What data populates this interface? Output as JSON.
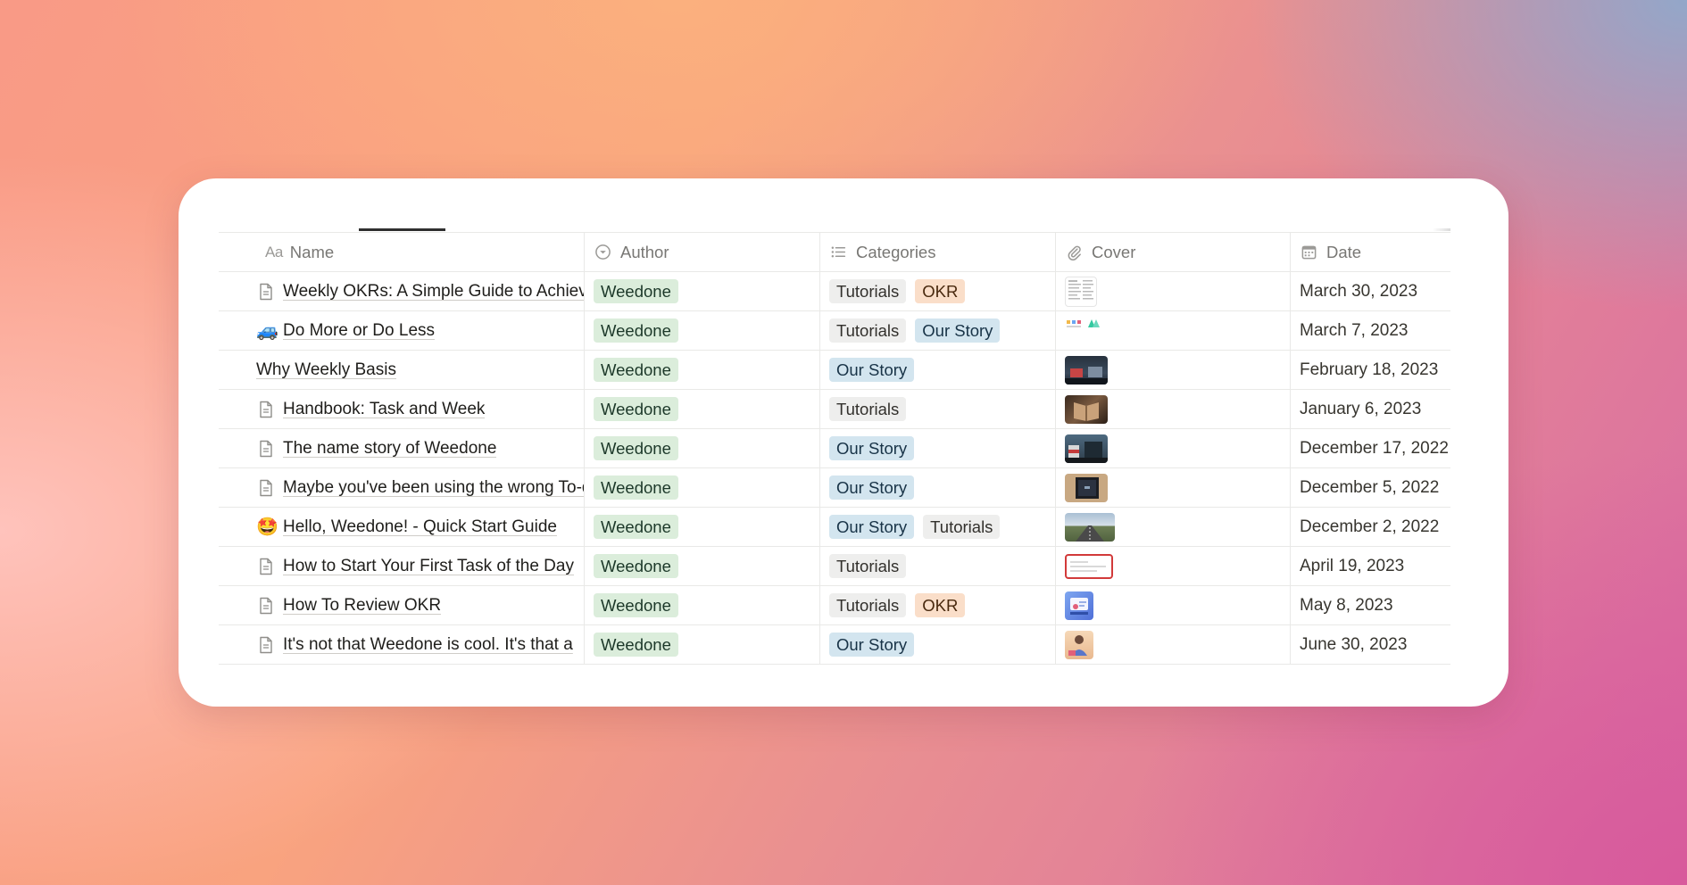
{
  "colors": {
    "tag_author": "#dbeddb",
    "tag_tutorials": "#eeeeed",
    "tag_okr": "#fadec9",
    "tag_our_story": "#d3e5ef"
  },
  "columns": {
    "name": {
      "label": "Name",
      "icon": "text-property-icon",
      "icon_text": "Aa"
    },
    "author": {
      "label": "Author",
      "icon": "select-property-icon"
    },
    "categories": {
      "label": "Categories",
      "icon": "list-property-icon"
    },
    "cover": {
      "label": "Cover",
      "icon": "paperclip-icon"
    },
    "date": {
      "label": "Date",
      "icon": "calendar-icon"
    }
  },
  "rows": [
    {
      "icon": "page-icon",
      "title": "Weekly OKRs: A Simple Guide to Achieve",
      "author": "Weedone",
      "categories": [
        "Tutorials",
        "OKR"
      ],
      "cover": "document-thumbnail",
      "date": "March 30, 2023"
    },
    {
      "icon": "emoji-icon",
      "emoji": "🚙",
      "title": "Do More or Do Less",
      "author": "Weedone",
      "categories": [
        "Tutorials",
        "Our Story"
      ],
      "cover": "colorful-icons-thumbnail",
      "date": "March 7, 2023"
    },
    {
      "icon": "none",
      "title": "Why Weekly Basis",
      "author": "Weedone",
      "categories": [
        "Our Story"
      ],
      "cover": "dark-photo-thumbnail",
      "date": "February 18, 2023"
    },
    {
      "icon": "page-icon",
      "title": "Handbook: Task and Week",
      "author": "Weedone",
      "categories": [
        "Tutorials"
      ],
      "cover": "book-photo-thumbnail",
      "date": "January 6, 2023"
    },
    {
      "icon": "page-icon",
      "title": "The name story of Weedone",
      "author": "Weedone",
      "categories": [
        "Our Story"
      ],
      "cover": "street-photo-thumbnail",
      "date": "December 17, 2022"
    },
    {
      "icon": "page-icon",
      "title": "Maybe you've been using the wrong To-do",
      "author": "Weedone",
      "categories": [
        "Our Story"
      ],
      "cover": "frame-photo-thumbnail",
      "date": "December 5, 2022"
    },
    {
      "icon": "emoji-icon",
      "emoji": "🤩",
      "title": "Hello, Weedone! - Quick Start Guide",
      "author": "Weedone",
      "categories": [
        "Our Story",
        "Tutorials"
      ],
      "cover": "road-photo-thumbnail",
      "date": "December 2, 2022"
    },
    {
      "icon": "page-icon",
      "title": "How to Start Your First Task of the Day",
      "author": "Weedone",
      "categories": [
        "Tutorials"
      ],
      "cover": "red-border-thumbnail",
      "date": "April 19, 2023"
    },
    {
      "icon": "page-icon",
      "title": "How To Review OKR",
      "author": "Weedone",
      "categories": [
        "Tutorials",
        "OKR"
      ],
      "cover": "illustration-thumbnail",
      "date": "May 8, 2023"
    },
    {
      "icon": "page-icon",
      "title": "It's not that Weedone is cool. It's that a",
      "author": "Weedone",
      "categories": [
        "Our Story"
      ],
      "cover": "person-illustration-thumbnail",
      "date": "June 30, 2023"
    }
  ]
}
